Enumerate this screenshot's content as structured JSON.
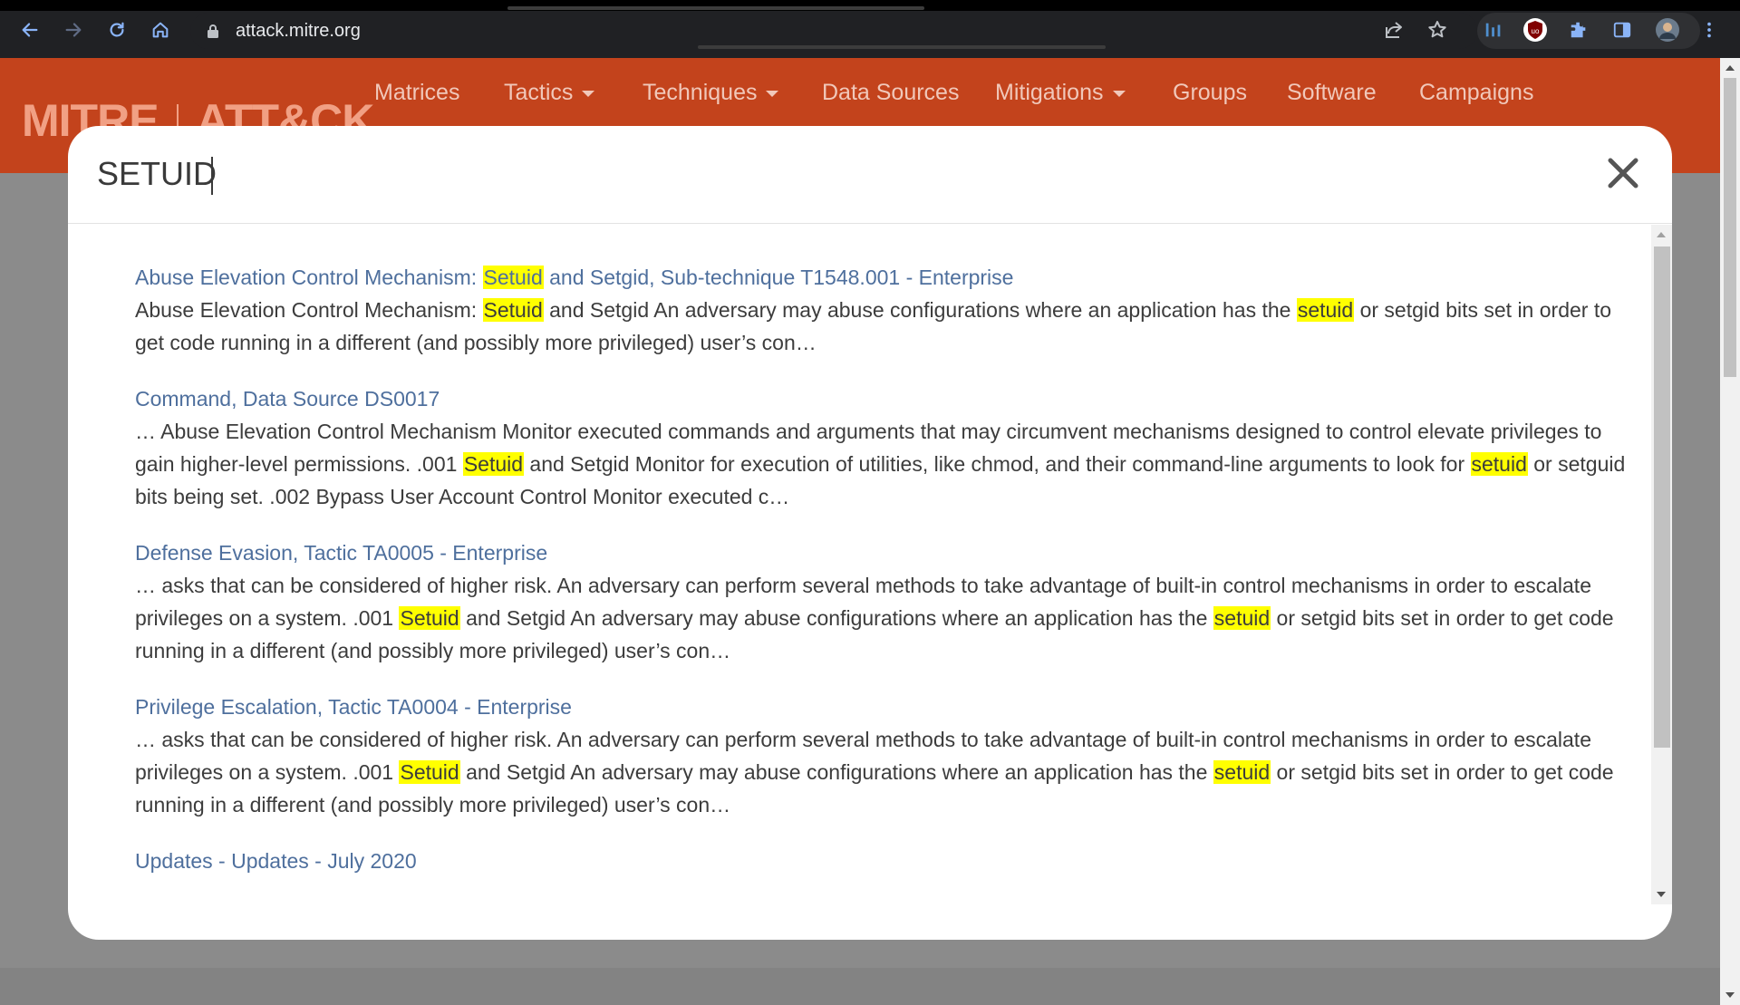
{
  "browser": {
    "url": "attack.mitre.org"
  },
  "site": {
    "logo_left": "MITRE",
    "logo_right": "ATT&CK",
    "nav": [
      {
        "label": "Matrices"
      },
      {
        "label": "Tactics"
      },
      {
        "label": "Techniques"
      },
      {
        "label": "Data Sources"
      },
      {
        "label": "Mitigations"
      },
      {
        "label": "Groups"
      },
      {
        "label": "Software"
      },
      {
        "label": "Campaigns"
      }
    ]
  },
  "search": {
    "query": "SETUID"
  },
  "results": [
    {
      "title": [
        "Abuse Elevation Control Mechanism: ",
        "Setuid",
        " and Setgid, Sub-technique T1548.001 - Enterprise"
      ],
      "text": [
        "Abuse Elevation Control Mechanism: ",
        "Setuid",
        " and Setgid An adversary may abuse configurations where an application has the ",
        "setuid",
        " or setgid bits set in order to get code running in a different (and possibly more privileged) user’s con…"
      ]
    },
    {
      "title": [
        "Command, Data Source DS0017"
      ],
      "text": [
        "… Abuse Elevation Control Mechanism Monitor executed commands and arguments that may circumvent mechanisms designed to control elevate privileges to gain higher-level permissions. .001 ",
        "Setuid",
        " and Setgid Monitor for execution of utilities, like chmod, and their command-line arguments to look for ",
        "setuid",
        " or setguid bits being set. .002 Bypass User Account Control Monitor executed c…"
      ]
    },
    {
      "title": [
        "Defense Evasion, Tactic TA0005 - Enterprise"
      ],
      "text": [
        "… asks that can be considered of higher risk. An adversary can perform several methods to take advantage of built-in control mechanisms in order to escalate privileges on a system. .001 ",
        "Setuid",
        " and Setgid An adversary may abuse configurations where an application has the ",
        "setuid",
        " or setgid bits set in order to get code running in a different (and possibly more privileged) user’s con…"
      ]
    },
    {
      "title": [
        "Privilege Escalation, Tactic TA0004 - Enterprise"
      ],
      "text": [
        "… asks that can be considered of higher risk. An adversary can perform several methods to take advantage of built-in control mechanisms in order to escalate privileges on a system. .001 ",
        "Setuid",
        " and Setgid An adversary may abuse configurations where an application has the ",
        "setuid",
        " or setgid bits set in order to get code running in a different (and possibly more privileged) user’s con…"
      ]
    },
    {
      "title": [
        "Updates - Updates - July 2020"
      ],
      "text": []
    }
  ],
  "icons": {
    "back": "arrow-left-icon",
    "forward": "arrow-right-icon",
    "reload": "reload-icon",
    "home": "home-icon",
    "lock": "lock-icon",
    "share": "share-icon",
    "bookmark": "star-icon",
    "close": "close-icon"
  },
  "colors": {
    "header": "#c3431c",
    "link": "#4e6f9d",
    "highlight": "#ffff00"
  }
}
